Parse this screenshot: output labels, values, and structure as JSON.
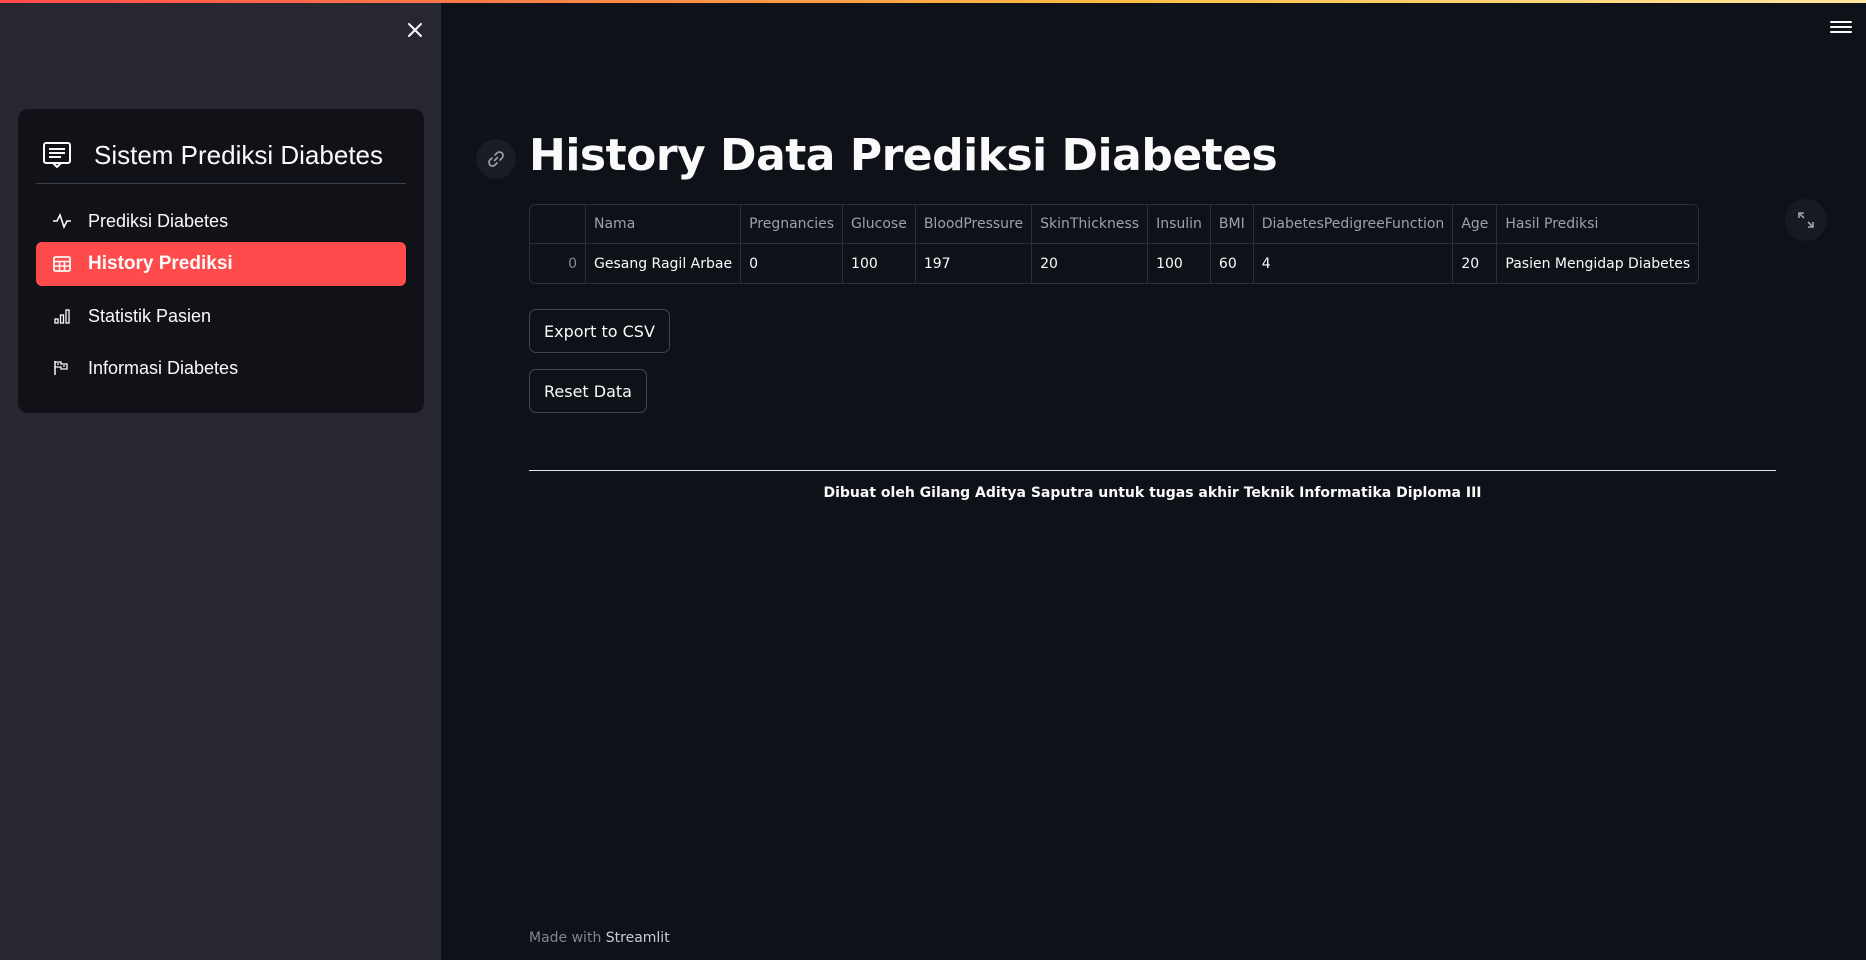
{
  "sidebar": {
    "title": "Sistem Prediksi Diabetes",
    "items": [
      {
        "label": "Prediksi Diabetes",
        "icon": "activity-icon",
        "active": false
      },
      {
        "label": "History Prediksi",
        "icon": "table-icon",
        "active": true
      },
      {
        "label": "Statistik Pasien",
        "icon": "bar-chart-icon",
        "active": false
      },
      {
        "label": "Informasi Diabetes",
        "icon": "info-flag-icon",
        "active": false
      }
    ]
  },
  "main": {
    "title": "History Data Prediksi Diabetes",
    "table": {
      "columns": [
        "",
        "Nama",
        "Pregnancies",
        "Glucose",
        "BloodPressure",
        "SkinThickness",
        "Insulin",
        "BMI",
        "DiabetesPedigreeFunction",
        "Age",
        "Hasil Prediksi"
      ],
      "rows": [
        [
          "0",
          "Gesang Ragil Arbae",
          "0",
          "100",
          "197",
          "20",
          "100",
          "60",
          "4",
          "20",
          "Pasien Mengidap Diabetes"
        ]
      ]
    },
    "export_label": "Export to CSV",
    "reset_label": "Reset Data",
    "footer_text": "Dibuat oleh Gilang Aditya Saputra untuk tugas akhir Teknik Informatika Diploma III"
  },
  "made_with": {
    "prefix": "Made with ",
    "brand": "Streamlit"
  },
  "colors": {
    "accent": "#ff4b4b",
    "background": "#0e1117",
    "sidebar": "#262730"
  }
}
